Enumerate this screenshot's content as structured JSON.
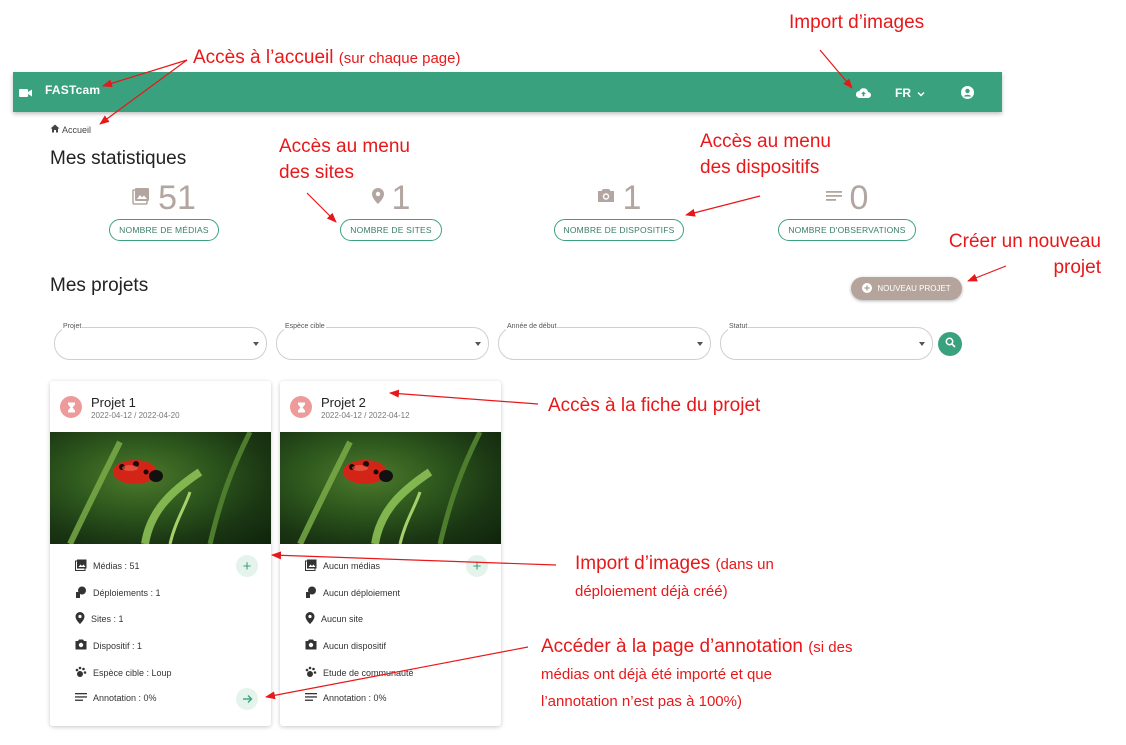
{
  "appbar": {
    "brand": "FASTcam",
    "lang": "FR"
  },
  "breadcrumb": {
    "label": "Accueil"
  },
  "stats_title": "Mes statistiques",
  "stats": [
    {
      "icon": "image-icon",
      "value": "51",
      "label": "NOMBRE DE MÉDIAS"
    },
    {
      "icon": "location-pin-icon",
      "value": "1",
      "label": "NOMBRE DE SITES"
    },
    {
      "icon": "camera-icon",
      "value": "1",
      "label": "NOMBRE DE DISPOSITIFS"
    },
    {
      "icon": "notes-icon",
      "value": "0",
      "label": "NOMBRE D'OBSERVATIONS"
    }
  ],
  "projects_title": "Mes projets",
  "new_project_label": "NOUVEAU PROJET",
  "filters": [
    {
      "label": "Projet",
      "value": ""
    },
    {
      "label": "Espèce cible",
      "value": ""
    },
    {
      "label": "Année de début",
      "value": ""
    },
    {
      "label": "Statut",
      "value": ""
    }
  ],
  "projects": [
    {
      "title": "Projet 1",
      "dates": "2022-04-12 / 2022-04-20",
      "medias": "Médias : 51",
      "deployments": "Déploiements : 1",
      "sites": "Sites : 1",
      "device": "Dispositif : 1",
      "species": "Espèce cible : Loup",
      "annotation": "Annotation : 0%"
    },
    {
      "title": "Projet 2",
      "dates": "2022-04-12 / 2022-04-12",
      "medias": "Aucun médias",
      "deployments": "Aucun déploiement",
      "sites": "Aucun site",
      "device": "Aucun dispositif",
      "species": "Etude de communauté",
      "annotation": "Annotation : 0%"
    }
  ],
  "annotations": {
    "import_top": "Import d’images",
    "home_main": "Accès à l’accueil",
    "home_small": "(sur chaque page)",
    "sites_line1": "Accès au menu",
    "sites_line2": "des sites",
    "devices_line1": "Accès au menu",
    "devices_line2": "des dispositifs",
    "new_line1": "Créer un nouveau",
    "new_line2": "projet",
    "fiche": "Accès à la fiche du projet",
    "import_main": "Import d’images",
    "import_small_1": "(dans un",
    "import_small_2": "déploiement déjà créé)",
    "annot_main": "Accéder à la page d’annotation",
    "annot_small_1": "(si des",
    "annot_small_2": "médias ont déjà été importé et que",
    "annot_small_3": "l’annotation n’est pas à 100%)"
  },
  "colors": {
    "primary": "#3aa17e",
    "annotation": "#e8181a",
    "stat_grey": "#b3a6a0",
    "new_project_bg": "#b5a49c",
    "avatar": "#ef9a9a"
  }
}
